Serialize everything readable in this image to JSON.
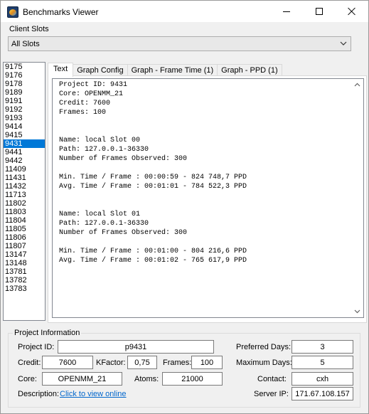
{
  "window": {
    "title": "Benchmarks Viewer",
    "icon": "app-icon",
    "controls": [
      "minimize-icon",
      "maximize-icon",
      "close-icon"
    ]
  },
  "client_slots": {
    "label": "Client Slots",
    "selected": "All Slots"
  },
  "project_list": {
    "items": [
      "9175",
      "9176",
      "9178",
      "9189",
      "9191",
      "9192",
      "9193",
      "9414",
      "9415",
      "9431",
      "9441",
      "9442",
      "11409",
      "11431",
      "11432",
      "11713",
      "11802",
      "11803",
      "11804",
      "11805",
      "11806",
      "11807",
      "13147",
      "13148",
      "13781",
      "13782",
      "13783"
    ],
    "selected": "9431"
  },
  "tabs": [
    {
      "label": "Text",
      "active": true
    },
    {
      "label": "Graph Config",
      "active": false
    },
    {
      "label": "Graph - Frame Time (1)",
      "active": false
    },
    {
      "label": "Graph - PPD (1)",
      "active": false
    }
  ],
  "text_report": {
    "lines": [
      "Project ID: 9431",
      "Core: OPENMM_21",
      "Credit: 7600",
      "Frames: 100",
      "",
      "",
      "Name: local Slot 00",
      "Path: 127.0.0.1-36330",
      "Number of Frames Observed: 300",
      "",
      "Min. Time / Frame : 00:00:59 - 824 748,7 PPD",
      "Avg. Time / Frame : 00:01:01 - 784 522,3 PPD",
      "",
      "",
      "Name: local Slot 01",
      "Path: 127.0.0.1-36330",
      "Number of Frames Observed: 300",
      "",
      "Min. Time / Frame : 00:01:00 - 804 216,6 PPD",
      "Avg. Time / Frame : 00:01:02 - 765 617,9 PPD"
    ]
  },
  "project_info": {
    "group_label": "Project Information",
    "project_id_label": "Project ID:",
    "project_id": "p9431",
    "credit_label": "Credit:",
    "credit": "7600",
    "kfactor_label": "KFactor:",
    "kfactor": "0,75",
    "frames_label": "Frames:",
    "frames": "100",
    "core_label": "Core:",
    "core": "OPENMM_21",
    "atoms_label": "Atoms:",
    "atoms": "21000",
    "description_label": "Description:",
    "description_link": "Click to view online",
    "preferred_days_label": "Preferred Days:",
    "preferred_days": "3",
    "maximum_days_label": "Maximum Days:",
    "maximum_days": "5",
    "contact_label": "Contact:",
    "contact": "cxh",
    "server_ip_label": "Server IP:",
    "server_ip": "171.67.108.157"
  },
  "colors": {
    "selection": "#0078d7",
    "link": "#0066cc",
    "window_bg": "#f0f0f0"
  }
}
